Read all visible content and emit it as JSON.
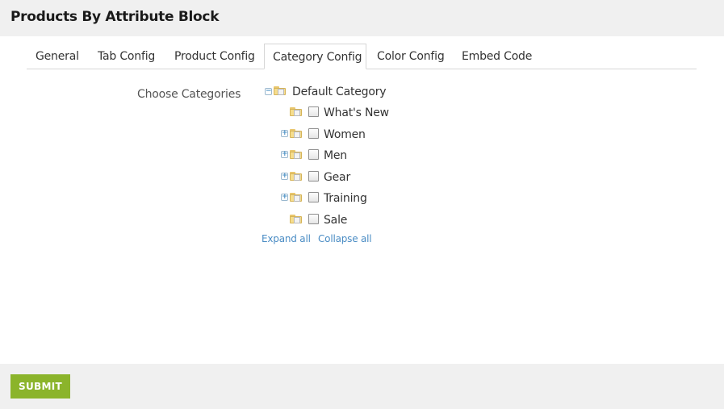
{
  "header": {
    "title": "Products By Attribute Block"
  },
  "tabs": [
    {
      "label": "General"
    },
    {
      "label": "Tab Config"
    },
    {
      "label": "Product Config"
    },
    {
      "label": "Category Config",
      "active": true
    },
    {
      "label": "Color Config"
    },
    {
      "label": "Embed Code"
    }
  ],
  "form": {
    "choose_label": "Choose Categories",
    "tree": {
      "root": {
        "label": "Default Category",
        "expanded": true
      },
      "children": [
        {
          "label": "What's New",
          "expandable": false,
          "checked": false
        },
        {
          "label": "Women",
          "expandable": true,
          "checked": false
        },
        {
          "label": "Men",
          "expandable": true,
          "checked": false
        },
        {
          "label": "Gear",
          "expandable": true,
          "checked": false
        },
        {
          "label": "Training",
          "expandable": true,
          "checked": false
        },
        {
          "label": "Sale",
          "expandable": false,
          "checked": false
        }
      ],
      "expand_all": "Expand all",
      "collapse_all": "Collapse all"
    }
  },
  "footer": {
    "submit_label": "SUBMIT"
  },
  "colors": {
    "accent": "#8bb42b",
    "link": "#4a8cc4",
    "bar_bg": "#f0f0f0"
  }
}
